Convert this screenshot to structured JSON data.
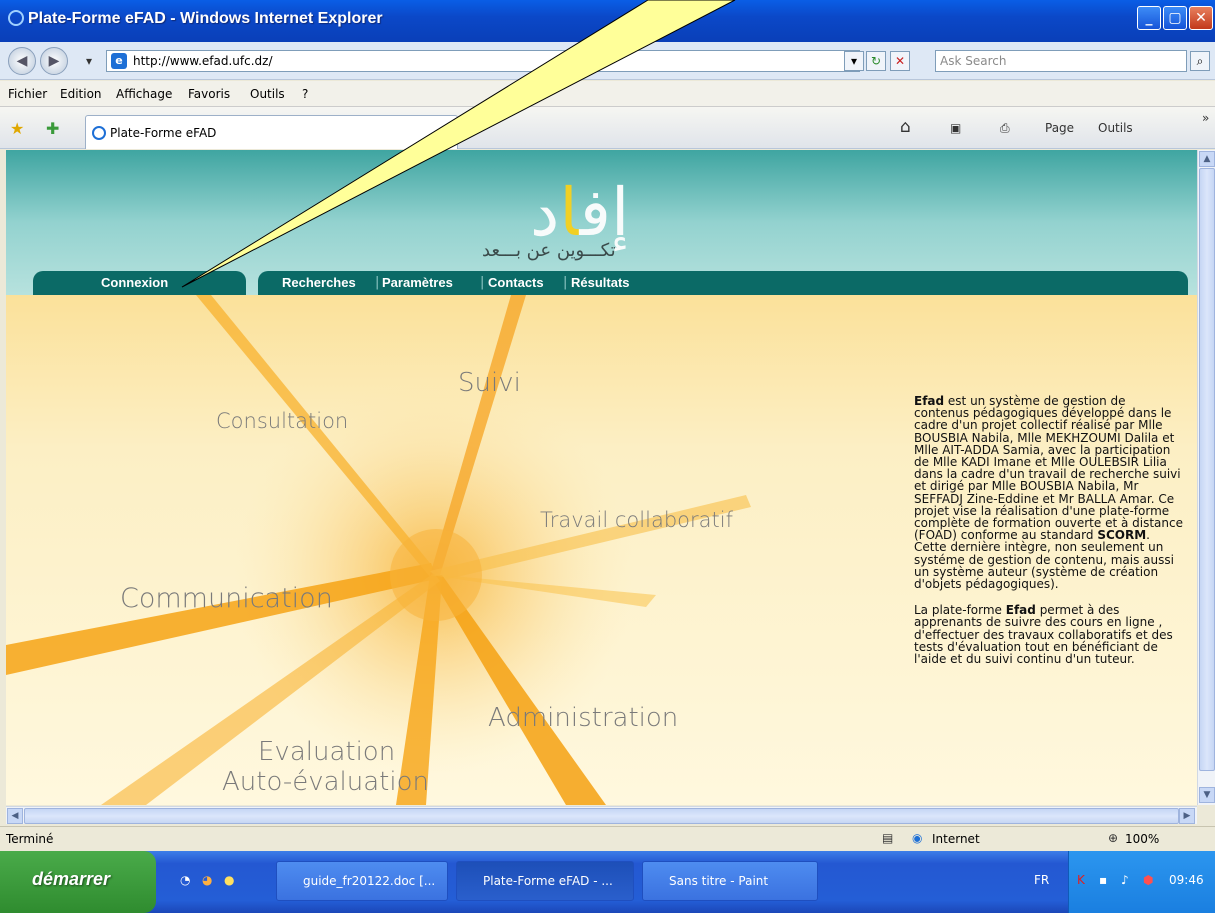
{
  "window": {
    "title": "Plate-Forme eFAD - Windows Internet Explorer",
    "controls": {
      "minimize": "_",
      "maximize": "▢",
      "close": "✕"
    }
  },
  "address": {
    "url": "http://www.efad.ufc.dz/",
    "search_placeholder": "Ask Search"
  },
  "menu": {
    "items": [
      "Fichier",
      "Edition",
      "Affichage",
      "Favoris",
      "Outils",
      "?"
    ]
  },
  "tabbar": {
    "tab_title": "Plate-Forme eFAD",
    "page_label": "Page",
    "tools_label": "Outils",
    "chevron": "»"
  },
  "page": {
    "logo_sub": "تكـــوين عن بـــعد",
    "nav_left": "Connexion",
    "nav_right": [
      "Recherches",
      "Paramètres",
      "Contacts",
      "Résultats"
    ],
    "nav_sep": "|",
    "rays": {
      "suivi": "Suivi",
      "consultation": "Consultation",
      "travail": "Travail collaboratif",
      "communication": "Communication",
      "administration": "Administration",
      "evaluation": "Evaluation",
      "auto": "Auto-évaluation"
    },
    "desc1_strong": "Efad",
    "desc1_text": " est un système de gestion de contenus pédagogiques développé dans le cadre d'un projet collectif réalisé par Mlle BOUSBIA Nabila, Mlle MEKHZOUMI Dalila et Mlle AIT-ADDA Samia, avec la participation de Mlle KADI Imane et Mlle OULEBSIR Lilia dans la cadre d'un travail de recherche suivi et dirigé par Mlle BOUSBIA Nabila, Mr SEFFADJ Zine-Eddine et Mr BALLA Amar. Ce projet vise la réalisation d'une plate-forme complète de formation ouverte et à distance (FOAD) conforme au standard ",
    "desc1_scorm": "SCORM",
    "desc1_tail": ". Cette dernière intègre, non seulement un systéme de gestion de contenu, mais aussi un système auteur (système de création d'objets pédagogiques).",
    "desc2_pre": "La plate-forme ",
    "desc2_strong": "Efad",
    "desc2_text": " permet à des apprenants de suivre des cours en ligne , d'effectuer des travaux collaboratifs et des tests d'évaluation tout en bénéficiant de l'aide et du suivi continu d'un tuteur."
  },
  "status": {
    "text": "Terminé",
    "zone": "Internet",
    "zoom": "100%"
  },
  "taskbar": {
    "start": "démarrer",
    "buttons": [
      "guide_fr20122.doc [...",
      "Plate-Forme eFAD - ...",
      "Sans titre - Paint"
    ],
    "lang": "FR",
    "clock": "09:46"
  },
  "colors": {
    "header_teal": "#3fa5a1",
    "nav_teal": "#0b6a66",
    "ray_orange": "#f7a41a",
    "callout_yellow": "#ffff99"
  }
}
